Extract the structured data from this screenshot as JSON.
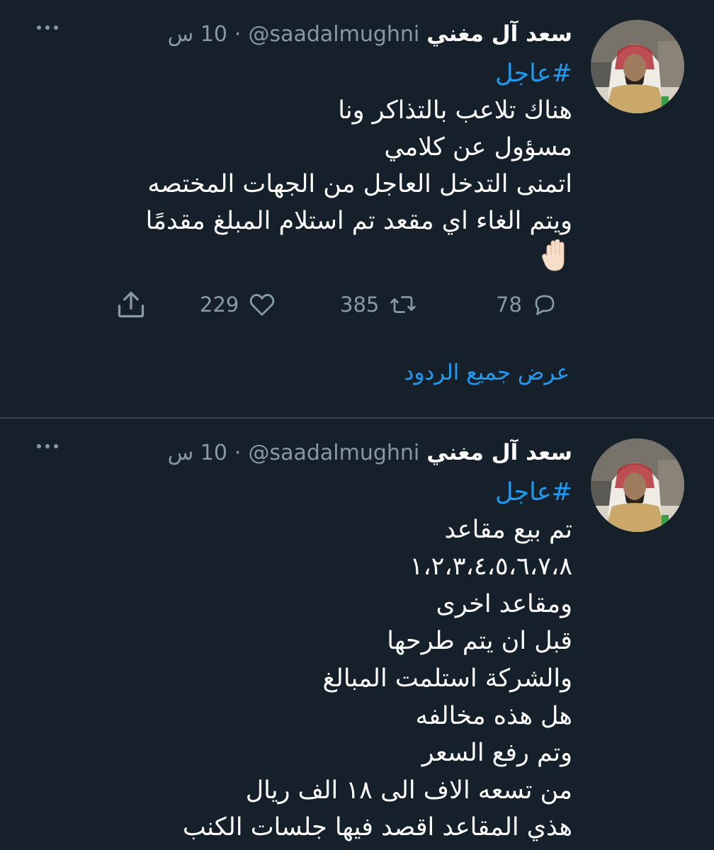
{
  "tweets": [
    {
      "display_name": "سعد آل مغني",
      "handle": "@saadalmughni",
      "separator": "·",
      "time": "10 س",
      "hashtag": "#عاجل",
      "lines": [
        "هناك تلاعب بالتذاكر ونا",
        "مسؤول عن كلامي",
        "اتمنى التدخل العاجل من الجهات المختصه",
        "ويتم الغاء اي مقعد تم استلام المبلغ مقدمًا"
      ],
      "emoji": "raised-hand-emoji",
      "actions": {
        "reply_count": "78",
        "retweet_count": "385",
        "like_count": "229"
      },
      "show_replies_label": "عرض جميع الردود"
    },
    {
      "display_name": "سعد آل مغني",
      "handle": "@saadalmughni",
      "separator": "·",
      "time": "10 س",
      "hashtag": "#عاجل",
      "lines": [
        "تم بيع مقاعد",
        "١،٢،٣،٤،٥،٦،٧،٨",
        "ومقاعد اخرى",
        "قبل ان يتم طرحها",
        "والشركة استلمت المبالغ",
        "هل هذه مخالفه",
        "وتم رفع السعر",
        "من تسعه الاف الى ١٨ الف ريال",
        "هذي المقاعد اقصد فيها جلسات الكنب"
      ]
    }
  ],
  "colors": {
    "background": "#15202b",
    "text": "#ffffff",
    "muted": "#8899a6",
    "accent": "#1d9bf0",
    "divider": "#38444d"
  },
  "icons": {
    "more": "more-dots-icon",
    "reply": "reply-bubble-icon",
    "retweet": "retweet-icon",
    "like": "heart-icon",
    "share": "share-upload-icon"
  }
}
